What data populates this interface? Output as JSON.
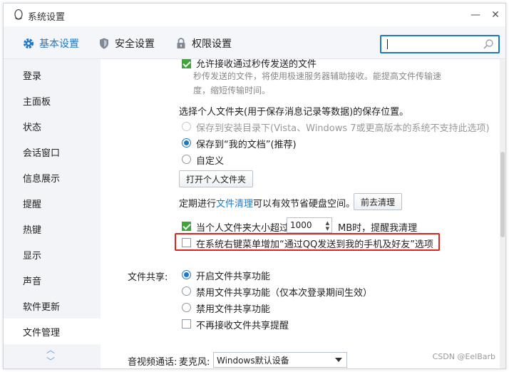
{
  "window": {
    "title": "系统设置",
    "min_glyph": "—",
    "close_glyph": "✕"
  },
  "tabs": [
    {
      "label": "基本设置",
      "icon": "gear-icon",
      "active": true
    },
    {
      "label": "安全设置",
      "icon": "shield-icon",
      "active": false
    },
    {
      "label": "权限设置",
      "icon": "lock-icon",
      "active": false
    }
  ],
  "search": {
    "placeholder": "",
    "value": ""
  },
  "sidebar": {
    "items": [
      {
        "label": "登录"
      },
      {
        "label": "主面板"
      },
      {
        "label": "状态"
      },
      {
        "label": "会话窗口"
      },
      {
        "label": "信息展示"
      },
      {
        "label": "提醒"
      },
      {
        "label": "热键"
      },
      {
        "label": "显示"
      },
      {
        "label": "声音"
      },
      {
        "label": "软件更新"
      },
      {
        "label": "文件管理",
        "active": true
      }
    ],
    "up_glyph": "︿",
    "down_glyph": "﹀"
  },
  "content": {
    "top_checkbox_label": "允许接收通过秒传发送的文件",
    "top_note": "秒传发送的文件，将使用极速服务器辅助接收。能提高文件传输速度，缩短传输时间。",
    "folder_heading": "选择个人文件夹(用于保存消息记录等数据)的保存位置。",
    "folder_options": [
      {
        "label": "保存到安装目录下(Vista、Windows 7或更高版本的系统不支持此选项)",
        "state": "disabled"
      },
      {
        "label": "保存到“我的文档”(推荐)",
        "state": "checked"
      },
      {
        "label": "自定义",
        "state": "unchecked"
      }
    ],
    "open_folder_button": "打开个人文件夹",
    "cleanup_prefix": "定期进行",
    "cleanup_link": "文件清理",
    "cleanup_suffix": "可以有效节省硬盘空间。",
    "cleanup_button": "前去清理",
    "size_limit_prefix": "当个人文件夹大小超过",
    "size_limit_value": "1000",
    "size_limit_suffix": "MB时，提醒我清理",
    "context_menu_label": "在系统右键菜单增加“通过QQ发送到我的手机及好友”选项",
    "file_share_label": "文件共享:",
    "file_share_options": [
      {
        "label": "开启文件共享功能",
        "state": "checked"
      },
      {
        "label": "禁用文件共享功能（仅本次登录期间生效）",
        "state": "unchecked"
      },
      {
        "label": "禁用文件共享功能",
        "state": "unchecked"
      }
    ],
    "no_share_reminder_label": "不再接收文件共享提醒",
    "av_label": "音视频通话:",
    "mic_label": "麦克风:",
    "mic_value": "Windows默认设备"
  },
  "watermark": "CSDN @EelBarb",
  "colors": {
    "accent": "#1e78c8",
    "check_green": "#39a935",
    "highlight_red": "#e2231a"
  }
}
